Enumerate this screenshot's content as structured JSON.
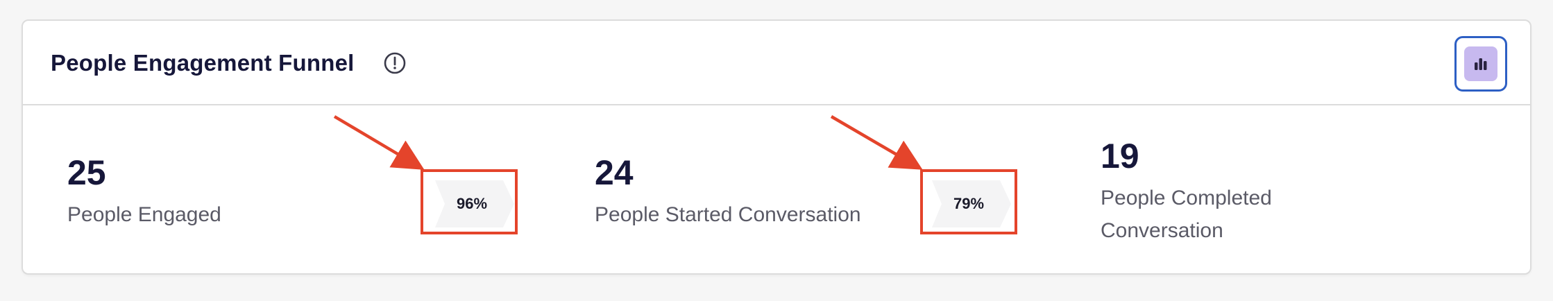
{
  "widget": {
    "title": "People Engagement Funnel",
    "info_icon": "info-circle-icon",
    "chart_toggle_icon": "bar-chart-icon"
  },
  "funnel": {
    "stages": [
      {
        "value": "25",
        "label": "People Engaged"
      },
      {
        "value": "24",
        "label": "People Started Conversation"
      },
      {
        "value": "19",
        "label_line1": "People Completed",
        "label_line2": "Conversation"
      }
    ],
    "conversions": [
      {
        "label": "96%"
      },
      {
        "label": "79%"
      }
    ]
  },
  "annotations": {
    "color": "#e4442b",
    "type": "red arrows and boxes highlighting conversion percentages"
  },
  "colors": {
    "text_primary": "#16173a",
    "text_secondary": "#5a5a66",
    "toggle_bg": "#c7b9ef",
    "toggle_border": "#2d5fc4",
    "badge_bg": "#f4f4f5"
  }
}
